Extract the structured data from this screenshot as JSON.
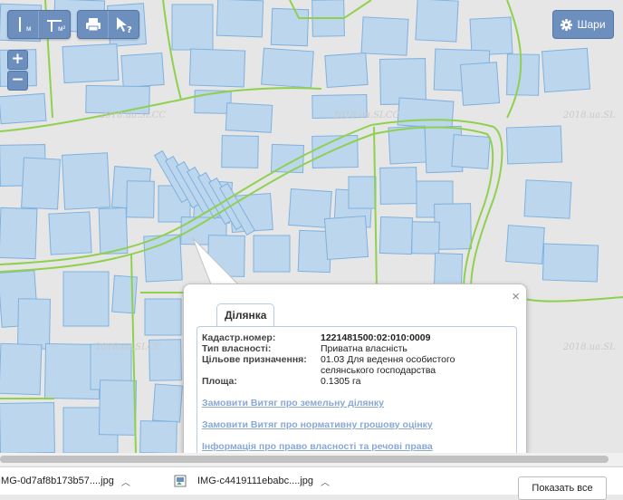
{
  "map": {
    "watermark": "2018.ua.SLCC",
    "watermark_partial": "2018.ua.SL"
  },
  "toolbar": {
    "ruler_label": "м",
    "area_label": "м²"
  },
  "zoom": {
    "in_label": "+",
    "out_label": "−"
  },
  "layers": {
    "label": "Шари"
  },
  "popup": {
    "close_label": "×",
    "tab_label": "Ділянка",
    "fields": [
      {
        "label": "Кадастр.номер:",
        "value": "1221481500:02:010:0009"
      },
      {
        "label": "Тип власності:",
        "value": "Приватна власність"
      },
      {
        "label": "Цільове призначення:",
        "value": "01.03 Для ведення особистого селянського господарства"
      },
      {
        "label": "Площа:",
        "value": "0.1305 га"
      }
    ],
    "links": [
      "Замовити Витяг про земельну ділянку",
      "Замовити Витяг про нормативну грошову оцінку",
      "Інформація про право власності та речові права"
    ]
  },
  "downloads": {
    "items": [
      {
        "name": "IMG-0d7af8b173b57....jpg"
      },
      {
        "name": "IMG-c4419111ebabc....jpg"
      }
    ],
    "show_all_label": "Показать все"
  },
  "colors": {
    "accent": "#6d8fbe",
    "parcel_fill": "#bcd6ee",
    "parcel_stroke": "#7fb1de",
    "road": "#8fd14f"
  }
}
